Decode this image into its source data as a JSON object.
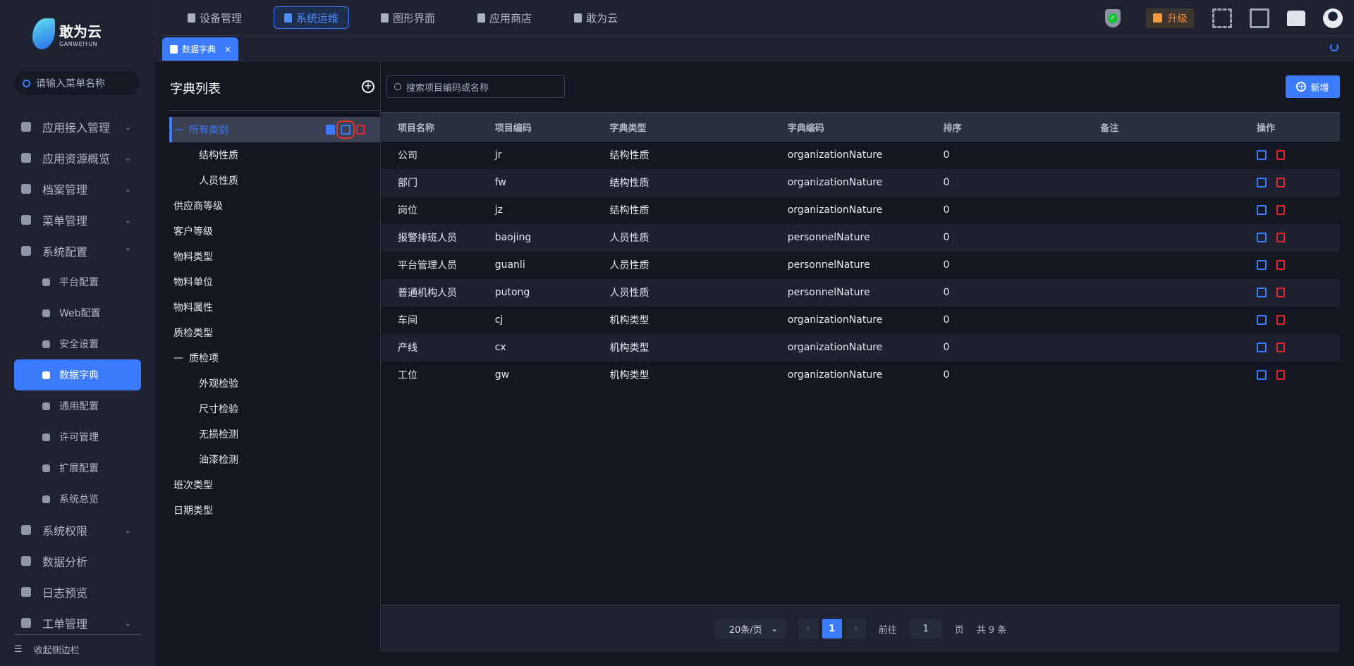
{
  "brand": {
    "name": "敢为云",
    "sub": "GANWEIYUN"
  },
  "menu_search": {
    "placeholder": "请输入菜单名称"
  },
  "sidebar": {
    "items": [
      {
        "label": "应用接入管理",
        "chev": "⌄",
        "sub": false
      },
      {
        "label": "应用资源概览",
        "chev": "⌄",
        "sub": false
      },
      {
        "label": "档案管理",
        "chev": "⌄",
        "sub": false
      },
      {
        "label": "菜单管理",
        "chev": "⌄",
        "sub": false
      },
      {
        "label": "系统配置",
        "chev": "⌃",
        "sub": false
      },
      {
        "label": "平台配置",
        "sub": true
      },
      {
        "label": "Web配置",
        "sub": true
      },
      {
        "label": "安全设置",
        "sub": true
      },
      {
        "label": "数据字典",
        "sub": true,
        "active": true
      },
      {
        "label": "通用配置",
        "sub": true
      },
      {
        "label": "许可管理",
        "sub": true
      },
      {
        "label": "扩展配置",
        "sub": true
      },
      {
        "label": "系统总览",
        "sub": true
      },
      {
        "label": "系统权限",
        "chev": "⌄",
        "sub": false
      },
      {
        "label": "数据分析",
        "sub": false
      },
      {
        "label": "日志预览",
        "sub": false
      },
      {
        "label": "工单管理",
        "chev": "⌄",
        "sub": false
      }
    ],
    "collapse": "收起侧边栏"
  },
  "topnav": [
    {
      "label": "设备管理"
    },
    {
      "label": "系统运维",
      "active": true
    },
    {
      "label": "图形界面"
    },
    {
      "label": "应用商店"
    },
    {
      "label": "敢为云"
    }
  ],
  "upgrade": "升级",
  "tab": {
    "label": "数据字典",
    "close": "×"
  },
  "dict": {
    "title": "字典列表",
    "add": "+",
    "tree": [
      {
        "label": "所有类别",
        "level": 1,
        "expanded": true,
        "selected": true
      },
      {
        "label": "结构性质",
        "level": 2
      },
      {
        "label": "人员性质",
        "level": 2
      },
      {
        "label": "供应商等级",
        "level": 1
      },
      {
        "label": "客户等级",
        "level": 1
      },
      {
        "label": "物料类型",
        "level": 1
      },
      {
        "label": "物料单位",
        "level": 1
      },
      {
        "label": "物料属性",
        "level": 1
      },
      {
        "label": "质检类型",
        "level": 1
      },
      {
        "label": "质检项",
        "level": 1,
        "expanded": true
      },
      {
        "label": "外观检验",
        "level": 2
      },
      {
        "label": "尺寸检验",
        "level": 2
      },
      {
        "label": "无损检测",
        "level": 2
      },
      {
        "label": "油漆检测",
        "level": 2
      },
      {
        "label": "班次类型",
        "level": 1
      },
      {
        "label": "日期类型",
        "level": 1
      }
    ]
  },
  "search": {
    "placeholder": "搜索项目编码或名称"
  },
  "add_button": "新增",
  "table": {
    "columns": [
      "项目名称",
      "项目编码",
      "字典类型",
      "字典编码",
      "排序",
      "备注",
      "操作"
    ],
    "rows": [
      [
        "公司",
        "jr",
        "结构性质",
        "organizationNature",
        "0",
        ""
      ],
      [
        "部门",
        "fw",
        "结构性质",
        "organizationNature",
        "0",
        ""
      ],
      [
        "岗位",
        "jz",
        "结构性质",
        "organizationNature",
        "0",
        ""
      ],
      [
        "报警排班人员",
        "baojing",
        "人员性质",
        "personnelNature",
        "0",
        ""
      ],
      [
        "平台管理人员",
        "guanli",
        "人员性质",
        "personnelNature",
        "0",
        ""
      ],
      [
        "普通机构人员",
        "putong",
        "人员性质",
        "personnelNature",
        "0",
        ""
      ],
      [
        "车间",
        "cj",
        "机构类型",
        "organizationNature",
        "0",
        ""
      ],
      [
        "产线",
        "cx",
        "机构类型",
        "organizationNature",
        "0",
        ""
      ],
      [
        "工位",
        "gw",
        "机构类型",
        "organizationNature",
        "0",
        ""
      ]
    ]
  },
  "pagination": {
    "page_size": "20条/页",
    "prev": "‹",
    "current": "1",
    "next": "›",
    "goto": "前往",
    "goto_value": "1",
    "page_unit": "页",
    "total": "共 9 条"
  }
}
